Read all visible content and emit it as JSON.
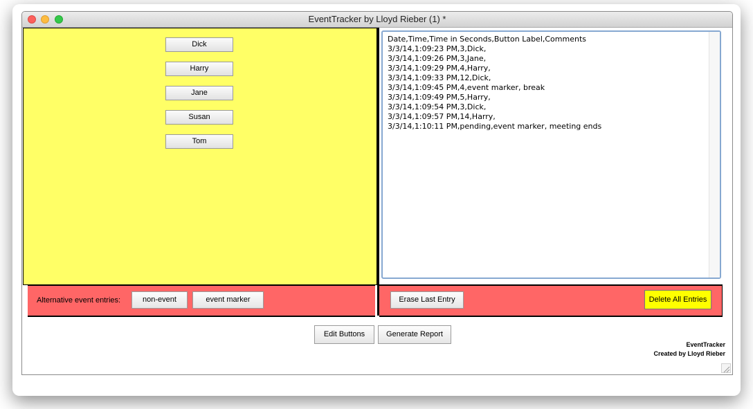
{
  "window": {
    "title": "EventTracker by Lloyd Rieber (1) *"
  },
  "participants": {
    "buttons": [
      "Dick",
      "Harry",
      "Jane",
      "Susan",
      "Tom"
    ]
  },
  "log": {
    "text": "Date,Time,Time in Seconds,Button Label,Comments\n3/3/14,1:09:23 PM,3,Dick,\n3/3/14,1:09:26 PM,3,Jane,\n3/3/14,1:09:29 PM,4,Harry,\n3/3/14,1:09:33 PM,12,Dick,\n3/3/14,1:09:45 PM,4,event marker, break\n3/3/14,1:09:49 PM,5,Harry,\n3/3/14,1:09:54 PM,3,Dick,\n3/3/14,1:09:57 PM,14,Harry,\n3/3/14,1:10:11 PM,pending,event marker, meeting ends"
  },
  "alt_entries": {
    "label": "Alternative event entries:",
    "non_event": "non-event",
    "event_marker": "event marker"
  },
  "log_controls": {
    "erase_last": "Erase Last Entry",
    "delete_all": "Delete All Entries"
  },
  "footer": {
    "edit_buttons": "Edit Buttons",
    "generate_report": "Generate Report",
    "app_name": "EventTracker",
    "creator": "Created by Lloyd Rieber"
  },
  "colors": {
    "panel_yellow": "#ffff66",
    "panel_red": "#ff6666",
    "delete_button": "#ffff00",
    "log_focus_border": "#86a8d1"
  }
}
